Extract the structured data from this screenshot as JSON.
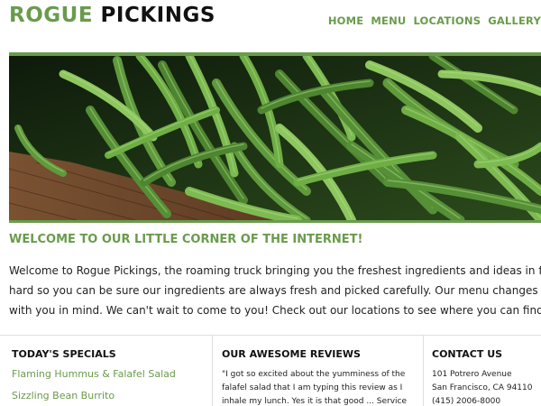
{
  "logo": {
    "part1": "ROGUE",
    "part2": "PICKINGS"
  },
  "nav": [
    "HOME",
    "MENU",
    "LOCATIONS",
    "GALLERY"
  ],
  "welcome": {
    "title": "WELCOME TO OUR LITTLE CORNER OF THE INTERNET!",
    "lines": [
      "Welcome to Rogue Pickings, the roaming truck bringing you the freshest ingredients and ideas in food. Our",
      "hard so you can be sure our ingredients are always fresh and picked carefully. Our menu changes every day",
      "with you in mind. We can't wait to come to you! Check out our locations to see where you can find us."
    ]
  },
  "specials": {
    "title": "TODAY'S SPECIALS",
    "items": [
      "Flaming Hummus & Falafel Salad",
      "Sizzling Bean Burrito"
    ]
  },
  "reviews": {
    "title": "OUR AWESOME REVIEWS",
    "text": "\"I got so excited about the yumminess of the falafel salad that I am typing this review as I inhale my lunch. Yes it is that good ... Service"
  },
  "contact": {
    "title": "CONTACT US",
    "address1": "101 Potrero Avenue",
    "address2": "San Francisco, CA 94110",
    "phone": "(415) 2006-8000"
  },
  "colors": {
    "accent": "#6a9b4c",
    "text": "#222222",
    "heading": "#111111"
  },
  "hero_image": "green-beans-photo"
}
